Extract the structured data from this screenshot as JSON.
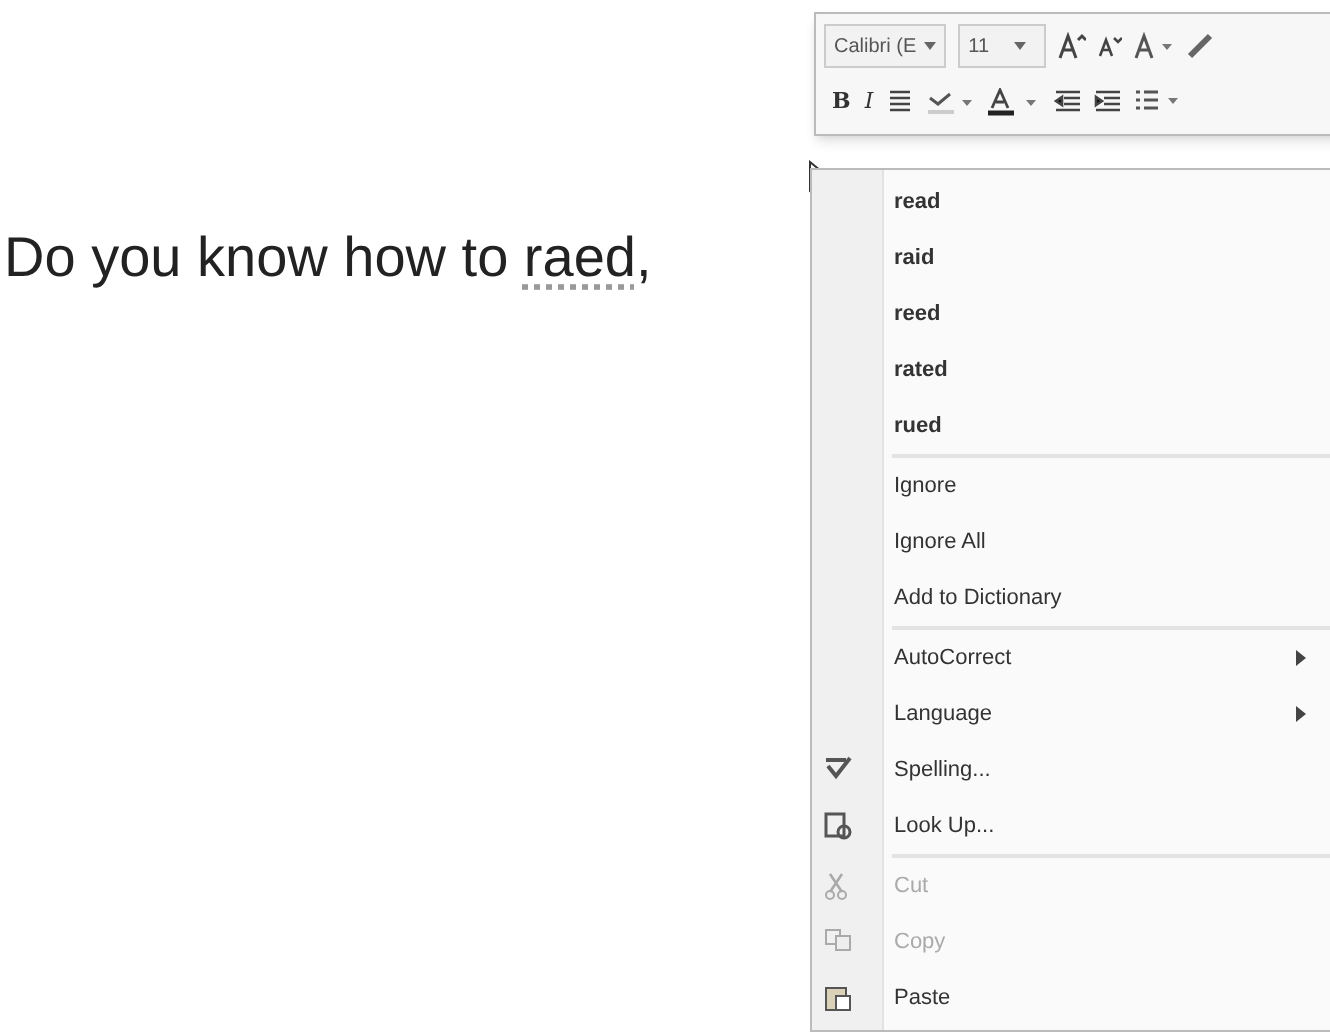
{
  "document": {
    "text_before": "Do you know how to ",
    "misspelled_word": "raed",
    "text_after": ","
  },
  "mini_toolbar": {
    "font": "Calibri (E",
    "size": "11",
    "bold_button": "B",
    "italic_button": "I"
  },
  "context_menu": {
    "sections": [
      [
        {
          "label": "read",
          "kind": "suggestion",
          "disabled": false
        },
        {
          "label": "raid",
          "kind": "suggestion",
          "disabled": false
        },
        {
          "label": "reed",
          "kind": "suggestion",
          "disabled": false
        },
        {
          "label": "rated",
          "kind": "suggestion",
          "disabled": false
        },
        {
          "label": "rued",
          "kind": "suggestion",
          "disabled": false
        }
      ],
      [
        {
          "label": "Ignore",
          "kind": "command",
          "disabled": false
        },
        {
          "label": "Ignore All",
          "kind": "command",
          "disabled": false
        },
        {
          "label": "Add to Dictionary",
          "kind": "command",
          "disabled": false
        }
      ],
      [
        {
          "label": "AutoCorrect",
          "kind": "submenu",
          "disabled": false
        },
        {
          "label": "Language",
          "kind": "submenu",
          "disabled": false
        },
        {
          "label": "Spelling...",
          "kind": "command",
          "disabled": false
        },
        {
          "label": "Look Up...",
          "kind": "command",
          "disabled": false
        }
      ],
      [
        {
          "label": "Cut",
          "kind": "command",
          "disabled": true
        },
        {
          "label": "Copy",
          "kind": "command",
          "disabled": true
        },
        {
          "label": "Paste",
          "kind": "command",
          "disabled": false
        }
      ]
    ]
  }
}
